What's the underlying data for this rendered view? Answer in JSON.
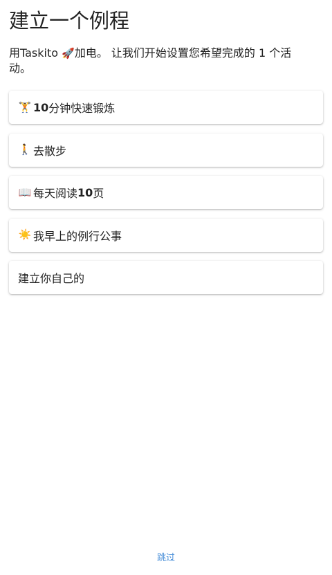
{
  "header": {
    "title": "建立一个例程",
    "subtitle_prefix": "用Taskito ",
    "subtitle_rocket": "🚀",
    "subtitle_suffix": "加电。 让我们开始设置您希望完成的 1 个活动。"
  },
  "options": [
    {
      "emoji": "🏋",
      "emoji_name": "weightlifter-icon",
      "num": "10",
      "label": " 分钟快速锻炼"
    },
    {
      "emoji": "🚶",
      "emoji_name": "walking-person-icon",
      "num": "",
      "label": "去散步"
    },
    {
      "emoji": "📖",
      "emoji_name": "open-book-icon",
      "label_prefix": "每天阅读 ",
      "num": "10",
      "label": " 页"
    },
    {
      "emoji": "☀️",
      "emoji_name": "sun-icon",
      "num": "",
      "label": "我早上的例行公事"
    },
    {
      "emoji": "",
      "num": "",
      "label": "建立你自己的"
    }
  ],
  "footer": {
    "skip_label": "跳过"
  },
  "colors": {
    "link": "#4a90d9",
    "text": "#222222",
    "background": "#ffffff"
  }
}
